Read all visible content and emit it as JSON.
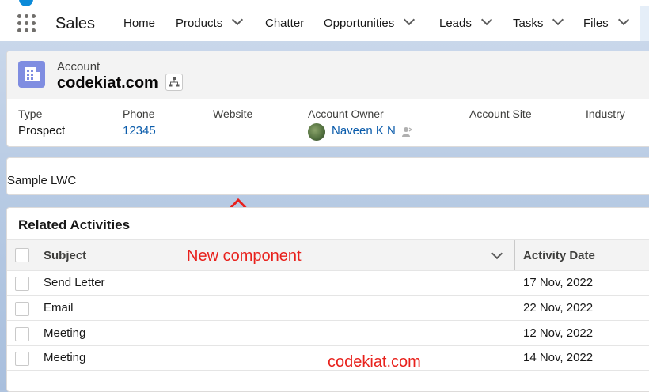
{
  "nav": {
    "app_name": "Sales",
    "items": [
      {
        "label": "Home",
        "has_menu": false
      },
      {
        "label": "Products",
        "has_menu": true
      },
      {
        "label": "Chatter",
        "has_menu": false
      },
      {
        "label": "Opportunities",
        "has_menu": true
      },
      {
        "label": "Leads",
        "has_menu": true
      },
      {
        "label": "Tasks",
        "has_menu": true
      },
      {
        "label": "Files",
        "has_menu": true
      }
    ]
  },
  "header": {
    "object_label": "Account",
    "record_name": "codekiat.com",
    "fields": [
      {
        "label": "Type",
        "value": "Prospect",
        "is_link": false
      },
      {
        "label": "Phone",
        "value": "12345",
        "is_link": true
      },
      {
        "label": "Website",
        "value": "",
        "is_link": false
      },
      {
        "label": "Account Owner",
        "value": "Naveen K N",
        "is_link": true
      },
      {
        "label": "Account Site",
        "value": "",
        "is_link": false
      },
      {
        "label": "Industry",
        "value": "",
        "is_link": false
      }
    ]
  },
  "lwc": {
    "text": "Sample LWC"
  },
  "related": {
    "title": "Related Activities",
    "columns": [
      "Subject",
      "Activity Date"
    ],
    "rows": [
      {
        "subject": "Send Letter",
        "date": "17 Nov, 2022"
      },
      {
        "subject": "Email",
        "date": "22 Nov, 2022"
      },
      {
        "subject": "Meeting",
        "date": "12 Nov, 2022"
      },
      {
        "subject": "Meeting",
        "date": "14 Nov, 2022"
      }
    ]
  },
  "annotations": {
    "new_component": "New component",
    "site": "codekiat.com",
    "color": "#e8211c"
  },
  "colors": {
    "link": "#0b5cab",
    "account_icon": "#7f8de1"
  }
}
